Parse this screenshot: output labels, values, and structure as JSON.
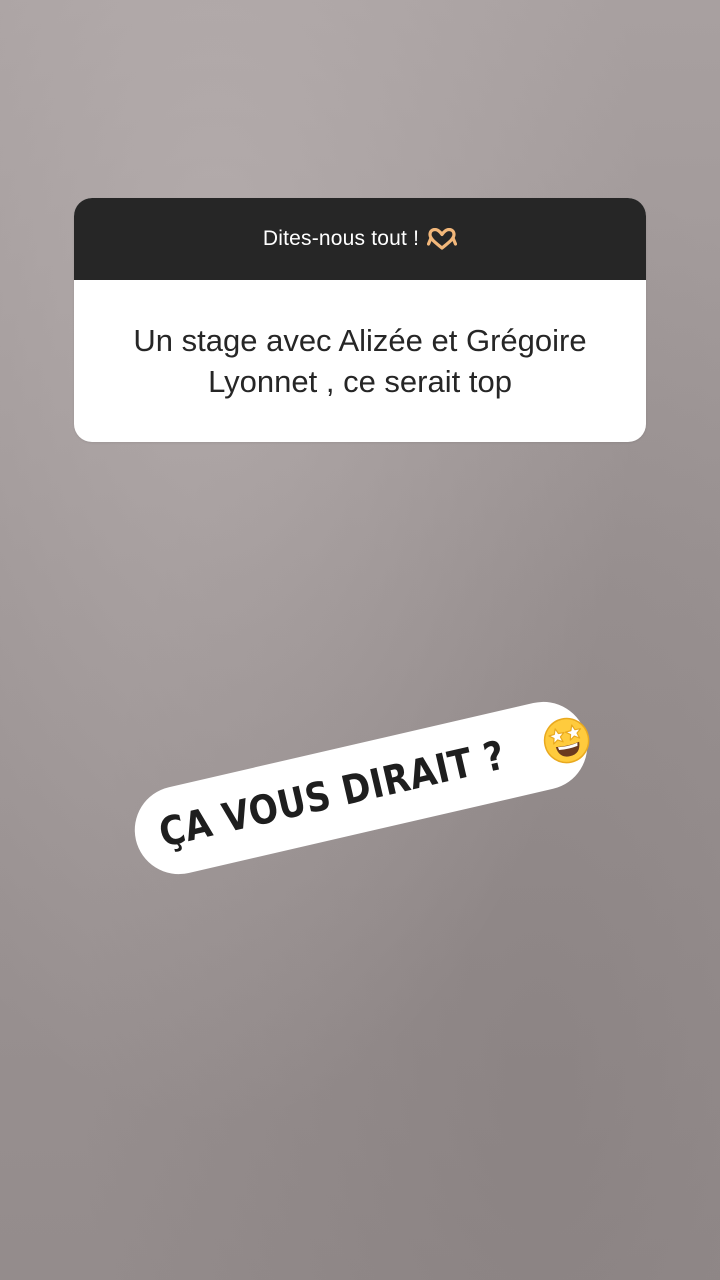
{
  "question_sticker": {
    "prompt": "Dites-nous tout !",
    "prompt_icon": "heart-hands-icon",
    "answer": "Un stage avec Alizée et Grégoire Lyonnet , ce serait top"
  },
  "text_sticker": {
    "text": "ÇA VOUS DIRAIT ?",
    "icon": "star-struck-icon"
  },
  "colors": {
    "header_bg": "#262626",
    "card_bg": "#ffffff",
    "background": "#9c9494"
  }
}
